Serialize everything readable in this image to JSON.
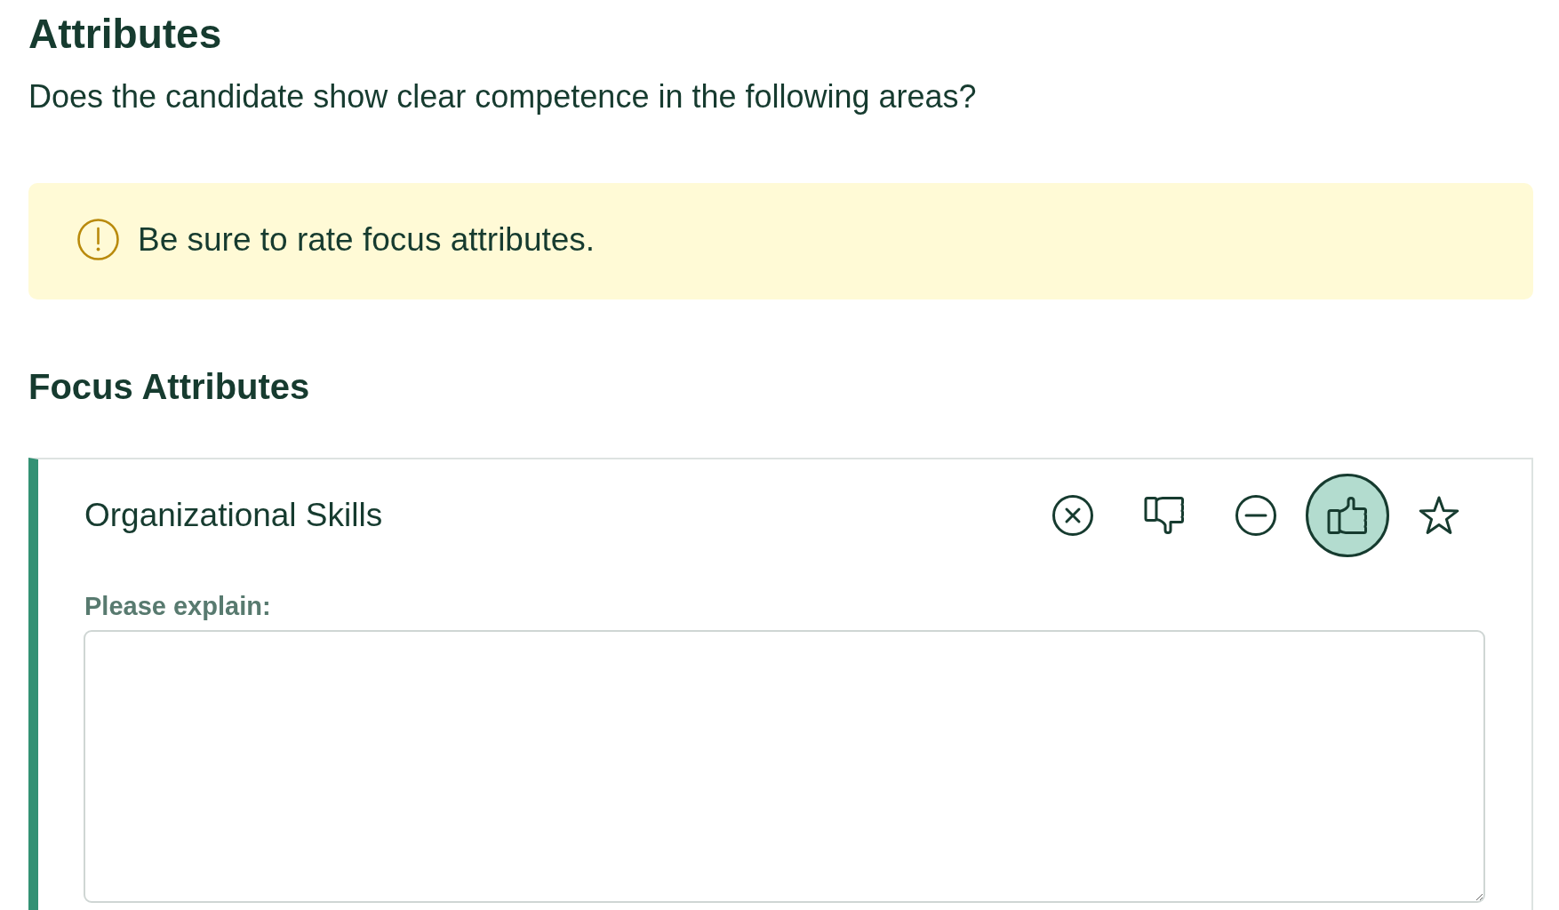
{
  "title": "Attributes",
  "subtitle": "Does the candidate show clear competence in the following areas?",
  "notice": {
    "text": "Be sure to rate focus attributes."
  },
  "section": {
    "title": "Focus Attributes",
    "attributes": [
      {
        "name": "Organizational Skills",
        "ratings": [
          {
            "kind": "cross",
            "selected": false
          },
          {
            "kind": "thumb_down",
            "selected": false
          },
          {
            "kind": "minus",
            "selected": false
          },
          {
            "kind": "thumb_up",
            "selected": true
          },
          {
            "kind": "star",
            "selected": false
          }
        ],
        "explain_label": "Please explain:"
      }
    ]
  }
}
